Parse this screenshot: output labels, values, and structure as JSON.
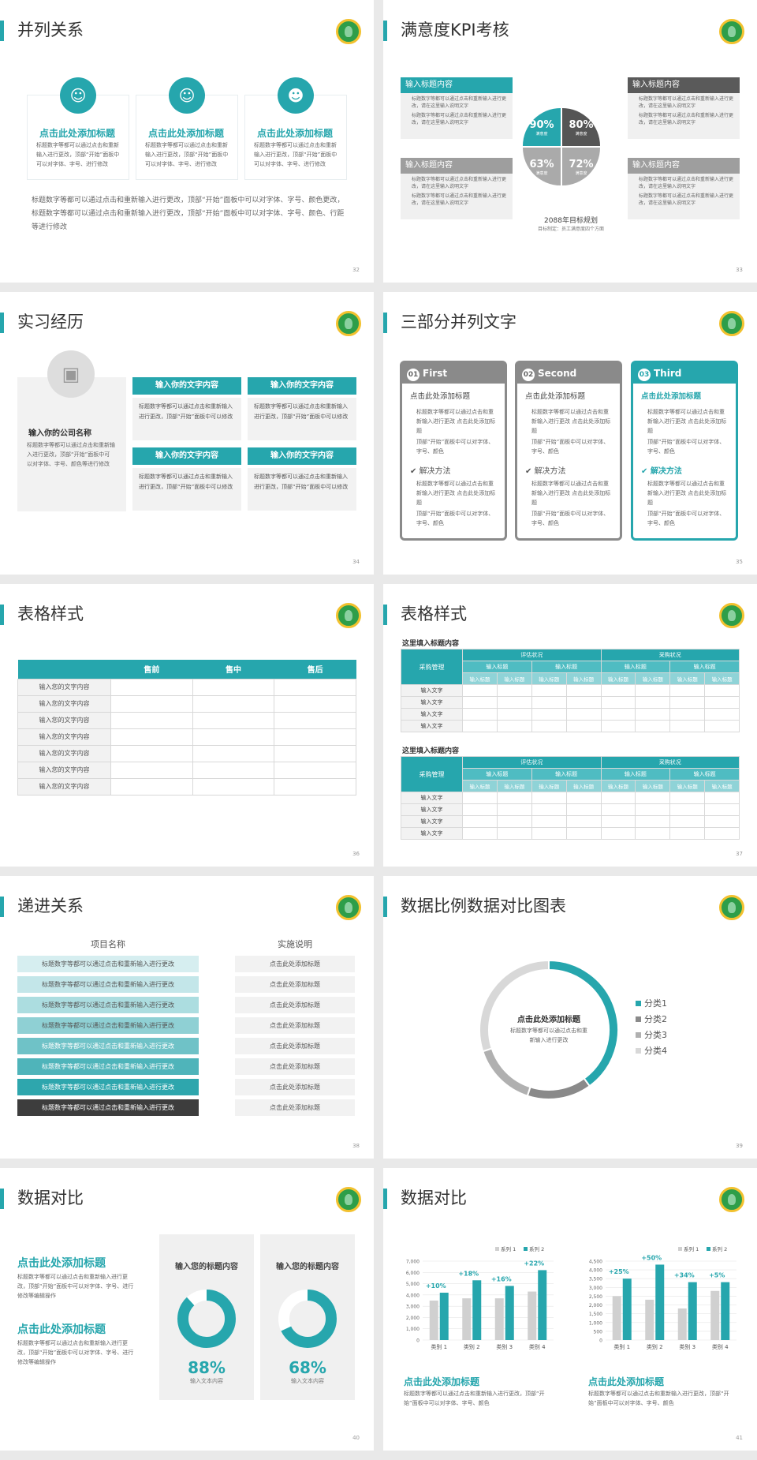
{
  "colors": {
    "accent": "#26a6ad",
    "gray": "#9e9e9e",
    "dark": "#5a5a5a",
    "light": "#d0d0d0"
  },
  "s32": {
    "title": "并列关系",
    "page": "32",
    "cards": [
      {
        "icon": "person-icon",
        "head": "点击此处添加标题",
        "text": "标题数字等都可以通过点击和重新输入进行更改，顶部“开始”面板中可以对字体、字号、进行修改"
      },
      {
        "icon": "doctor-icon",
        "head": "点击此处添加标题",
        "text": "标题数字等都可以通过点击和重新输入进行更改，顶部“开始”面板中可以对字体、字号、进行修改"
      },
      {
        "icon": "presenter-icon",
        "head": "点击此处添加标题",
        "text": "标题数字等都可以通过点击和重新输入进行更改，顶部“开始”面板中可以对字体、字号、进行修改"
      }
    ],
    "body": "标题数字等都可以通过点击和重新输入进行更改，顶部“开始”面板中可以对字体、字号、颜色更改，标题数字等都可以通过点击和重新输入进行更改，顶部“开始”面板中可以对字体、字号、颜色、行距等进行修改"
  },
  "s33": {
    "title": "满意度KPI考核",
    "page": "33",
    "boxes": [
      {
        "head": "输入标题内容",
        "items": [
          "标题数字等都可以通过点击和重新输入进行更改，请在这里输入说明文字",
          "标题数字等都可以通过点击和重新输入进行更改，请在这里输入说明文字"
        ]
      },
      {
        "head": "输入标题内容",
        "items": [
          "标题数字等都可以通过点击和重新输入进行更改，请在这里输入说明文字",
          "标题数字等都可以通过点击和重新输入进行更改，请在这里输入说明文字"
        ]
      },
      {
        "head": "输入标题内容",
        "items": [
          "标题数字等都可以通过点击和重新输入进行更改，请在这里输入说明文字",
          "标题数字等都可以通过点击和重新输入进行更改，请在这里输入说明文字"
        ]
      },
      {
        "head": "输入标题内容",
        "items": [
          "标题数字等都可以通过点击和重新输入进行更改，请在这里输入说明文字",
          "标题数字等都可以通过点击和重新输入进行更改，请在这里输入说明文字"
        ]
      }
    ],
    "kpis": [
      {
        "value": "90%",
        "label": "满意度"
      },
      {
        "value": "80%",
        "label": "满意度"
      },
      {
        "value": "63%",
        "label": "满意度"
      },
      {
        "value": "72%",
        "label": "满意度"
      }
    ],
    "plan": "2088年目标规划",
    "plan_sub": "目标制定：员工满意度四个方面"
  },
  "s34": {
    "title": "实习经历",
    "page": "34",
    "company": "输入你的公司名称",
    "company_text": "标题数字等都可以通过点击和重新输入进行更改，顶部“开始”面板中可以对字体、字号、颜色等进行修改",
    "items": [
      {
        "head": "输入你的文字内容",
        "text": "标题数字等都可以通过点击和重新输入进行更改，顶部“开始”面板中可以修改"
      },
      {
        "head": "输入你的文字内容",
        "text": "标题数字等都可以通过点击和重新输入进行更改，顶部“开始”面板中可以修改"
      },
      {
        "head": "输入你的文字内容",
        "text": "标题数字等都可以通过点击和重新输入进行更改，顶部“开始”面板中可以修改"
      },
      {
        "head": "输入你的文字内容",
        "text": "标题数字等都可以通过点击和重新输入进行更改，顶部“开始”面板中可以修改"
      }
    ]
  },
  "s35": {
    "title": "三部分并列文字",
    "page": "35",
    "cards": [
      {
        "num": "01",
        "name": "First",
        "head": "点击此处添加标题",
        "b1": "标题数字等都可以通过点击和重新输入进行更改 点击此处添加标题",
        "b2": "顶部“开始”面板中可以对字体、字号、颜色",
        "sol": "解决方法",
        "n1": "标题数字等都可以通过点击和重新输入进行更改 点击此处添加标题",
        "n2": "顶部“开始”面板中可以对字体、字号、颜色"
      },
      {
        "num": "02",
        "name": "Second",
        "head": "点击此处添加标题",
        "b1": "标题数字等都可以通过点击和重新输入进行更改 点击此处添加标题",
        "b2": "顶部“开始”面板中可以对字体、字号、颜色",
        "sol": "解决方法",
        "n1": "标题数字等都可以通过点击和重新输入进行更改 点击此处添加标题",
        "n2": "顶部“开始”面板中可以对字体、字号、颜色"
      },
      {
        "num": "03",
        "name": "Third",
        "head": "点击此处添加标题",
        "b1": "标题数字等都可以通过点击和重新输入进行更改 点击此处添加标题",
        "b2": "顶部“开始”面板中可以对字体、字号、颜色",
        "sol": "解决方法",
        "n1": "标题数字等都可以通过点击和重新输入进行更改 点击此处添加标题",
        "n2": "顶部“开始”面板中可以对字体、字号、颜色"
      }
    ]
  },
  "s36": {
    "title": "表格样式",
    "page": "36",
    "headers": [
      "售前",
      "售中",
      "售后"
    ],
    "rows": [
      "输入您的文字内容",
      "输入您的文字内容",
      "输入您的文字内容",
      "输入您的文字内容",
      "输入您的文字内容",
      "输入您的文字内容",
      "输入您的文字内容"
    ]
  },
  "s37": {
    "title": "表格样式",
    "page": "37",
    "table_title": "这里填入标题内容",
    "row_head": "采购管理",
    "groups": [
      "评估状况",
      "采购状况"
    ],
    "sub": "输入标题",
    "leaf": "输入标题",
    "rows": [
      "输入文字",
      "输入文字",
      "输入文字",
      "输入文字"
    ]
  },
  "s38": {
    "title": "递进关系",
    "page": "38",
    "col1": "项目名称",
    "col2": "实施说明",
    "left": [
      "标题数字等都可以通过点击和重新输入进行更改",
      "标题数字等都可以通过点击和重新输入进行更改",
      "标题数字等都可以通过点击和重新输入进行更改",
      "标题数字等都可以通过点击和重新输入进行更改",
      "标题数字等都可以通过点击和重新输入进行更改",
      "标题数字等都可以通过点击和重新输入进行更改",
      "标题数字等都可以通过点击和重新输入进行更改",
      "标题数字等都可以通过点击和重新输入进行更改"
    ],
    "right": [
      "点击此处添加标题",
      "点击此处添加标题",
      "点击此处添加标题",
      "点击此处添加标题",
      "点击此处添加标题",
      "点击此处添加标题",
      "点击此处添加标题",
      "点击此处添加标题"
    ]
  },
  "s39": {
    "title": "数据比例数据对比图表",
    "page": "39",
    "center_title": "点击此处添加标题",
    "center_text": "标题数字等都可以通过点击和重新输入进行更改"
  },
  "s40": {
    "title": "数据对比",
    "page": "40",
    "blocks": [
      {
        "head": "点击此处添加标题",
        "text": "标题数字等都可以通过点击和重新输入进行更改，顶部“开始”面板中可以对字体、字号、进行修改等编辑操作"
      },
      {
        "head": "点击此处添加标题",
        "text": "标题数字等都可以通过点击和重新输入进行更改，顶部“开始”面板中可以对字体、字号、进行修改等编辑操作"
      }
    ],
    "gauges": [
      {
        "label": "输入您的标题内容",
        "pct": "88%",
        "sub": "输入文本内容"
      },
      {
        "label": "输入您的标题内容",
        "pct": "68%",
        "sub": "输入文本内容"
      }
    ]
  },
  "s41": {
    "title": "数据对比",
    "page": "41",
    "captions": [
      {
        "head": "点击此处添加标题",
        "text": "标题数字等都可以通过点击和重新输入进行更改，顶部“开始”面板中可以对字体、字号、颜色"
      },
      {
        "head": "点击此处添加标题",
        "text": "标题数字等都可以通过点击和重新输入进行更改，顶部“开始”面板中可以对字体、字号、颜色"
      }
    ]
  },
  "chart_data": [
    {
      "type": "pie",
      "title": "",
      "categories": [
        "分类1",
        "分类2",
        "分类3",
        "分类4"
      ],
      "values": [
        40,
        15,
        15,
        30
      ],
      "colors": [
        "#26a6ad",
        "#8a8a8a",
        "#b0b0b0",
        "#d8d8d8"
      ],
      "legend": "right"
    },
    {
      "type": "pie",
      "title": "",
      "categories": [
        "88%"
      ],
      "values": [
        88,
        12
      ],
      "colors": [
        "#26a6ad",
        "#ffffff"
      ]
    },
    {
      "type": "pie",
      "title": "",
      "categories": [
        "68%"
      ],
      "values": [
        68,
        32
      ],
      "colors": [
        "#26a6ad",
        "#ffffff"
      ]
    },
    {
      "type": "bar",
      "categories": [
        "类别 1",
        "类别 2",
        "类别 3",
        "类别 4"
      ],
      "series": [
        {
          "name": "系列 1",
          "values": [
            3500,
            3700,
            3700,
            4300
          ]
        },
        {
          "name": "系列 2",
          "values": [
            4200,
            5300,
            4800,
            6200
          ]
        }
      ],
      "annotations": [
        "+10%",
        "+18%",
        "+16%",
        "+22%"
      ],
      "ylim": [
        0,
        7000
      ],
      "yticks": [
        "0",
        "1,000",
        "2,000",
        "3,000",
        "4,000",
        "5,000",
        "6,000",
        "7,000"
      ],
      "legend": "top-right"
    },
    {
      "type": "bar",
      "categories": [
        "类别 1",
        "类别 2",
        "类别 3",
        "类别 4"
      ],
      "series": [
        {
          "name": "系列 1",
          "values": [
            2500,
            2300,
            1800,
            2800
          ]
        },
        {
          "name": "系列 2",
          "values": [
            3500,
            4300,
            3300,
            3300
          ]
        }
      ],
      "annotations": [
        "+25%",
        "+50%",
        "+34%",
        "+5%"
      ],
      "ylim": [
        0,
        4500
      ],
      "yticks": [
        "0",
        "500",
        "1,000",
        "1,500",
        "2,000",
        "2,500",
        "3,000",
        "3,500",
        "4,000",
        "4,500"
      ],
      "legend": "top-right"
    }
  ]
}
